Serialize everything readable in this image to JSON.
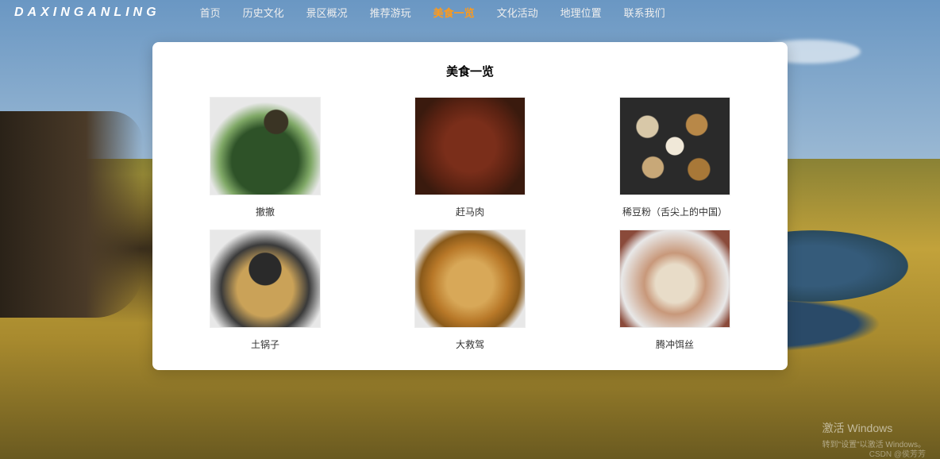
{
  "logo": "DAXINGANLING",
  "nav": {
    "items": [
      "首页",
      "历史文化",
      "景区概况",
      "推荐游玩",
      "美食一览",
      "文化活动",
      "地理位置",
      "联系我们"
    ],
    "activeIndex": 4
  },
  "card": {
    "title": "美食一览",
    "foods": [
      {
        "name": "撤撤"
      },
      {
        "name": "赶马肉"
      },
      {
        "name": "稀豆粉（舌尖上的中国）"
      },
      {
        "name": "土锅子"
      },
      {
        "name": "大救驾"
      },
      {
        "name": "腾冲饵丝"
      }
    ]
  },
  "watermark": {
    "title": "激活 Windows",
    "sub": "转到\"设置\"以激活 Windows。"
  },
  "csdn": "CSDN @侯芳芳"
}
